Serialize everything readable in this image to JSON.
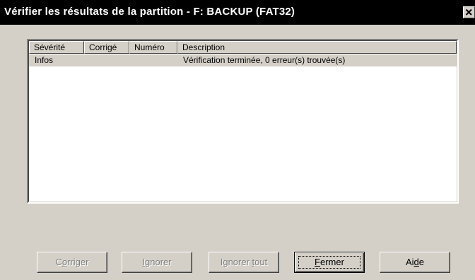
{
  "window": {
    "title": "Vérifier les résultats de la partition - F: BACKUP (FAT32)",
    "close_symbol": "×"
  },
  "listview": {
    "columns": [
      "Sévérité",
      "Corrigé",
      "Numéro",
      "Description"
    ],
    "rows": [
      {
        "severity": "Infos",
        "fixed": "",
        "number": "",
        "description": "Vérification terminée, 0 erreur(s) trouvée(s)"
      }
    ]
  },
  "buttons": {
    "corriger": {
      "pre": "C",
      "accel": "o",
      "post": "rriger",
      "enabled": false
    },
    "ignorer": {
      "pre": "",
      "accel": "I",
      "post": "gnorer",
      "enabled": false
    },
    "ignorer_tout": {
      "pre": "Ignorer ",
      "accel": "t",
      "post": "out",
      "enabled": false
    },
    "fermer": {
      "pre": "",
      "accel": "F",
      "post": "ermer",
      "enabled": true,
      "default": true
    },
    "aide": {
      "pre": "Ai",
      "accel": "d",
      "post": "e",
      "enabled": true
    }
  },
  "colors": {
    "face": "#d4d0c8",
    "titlebar": "#000000",
    "title_text": "#ffffff",
    "disabled_text": "#808080"
  }
}
